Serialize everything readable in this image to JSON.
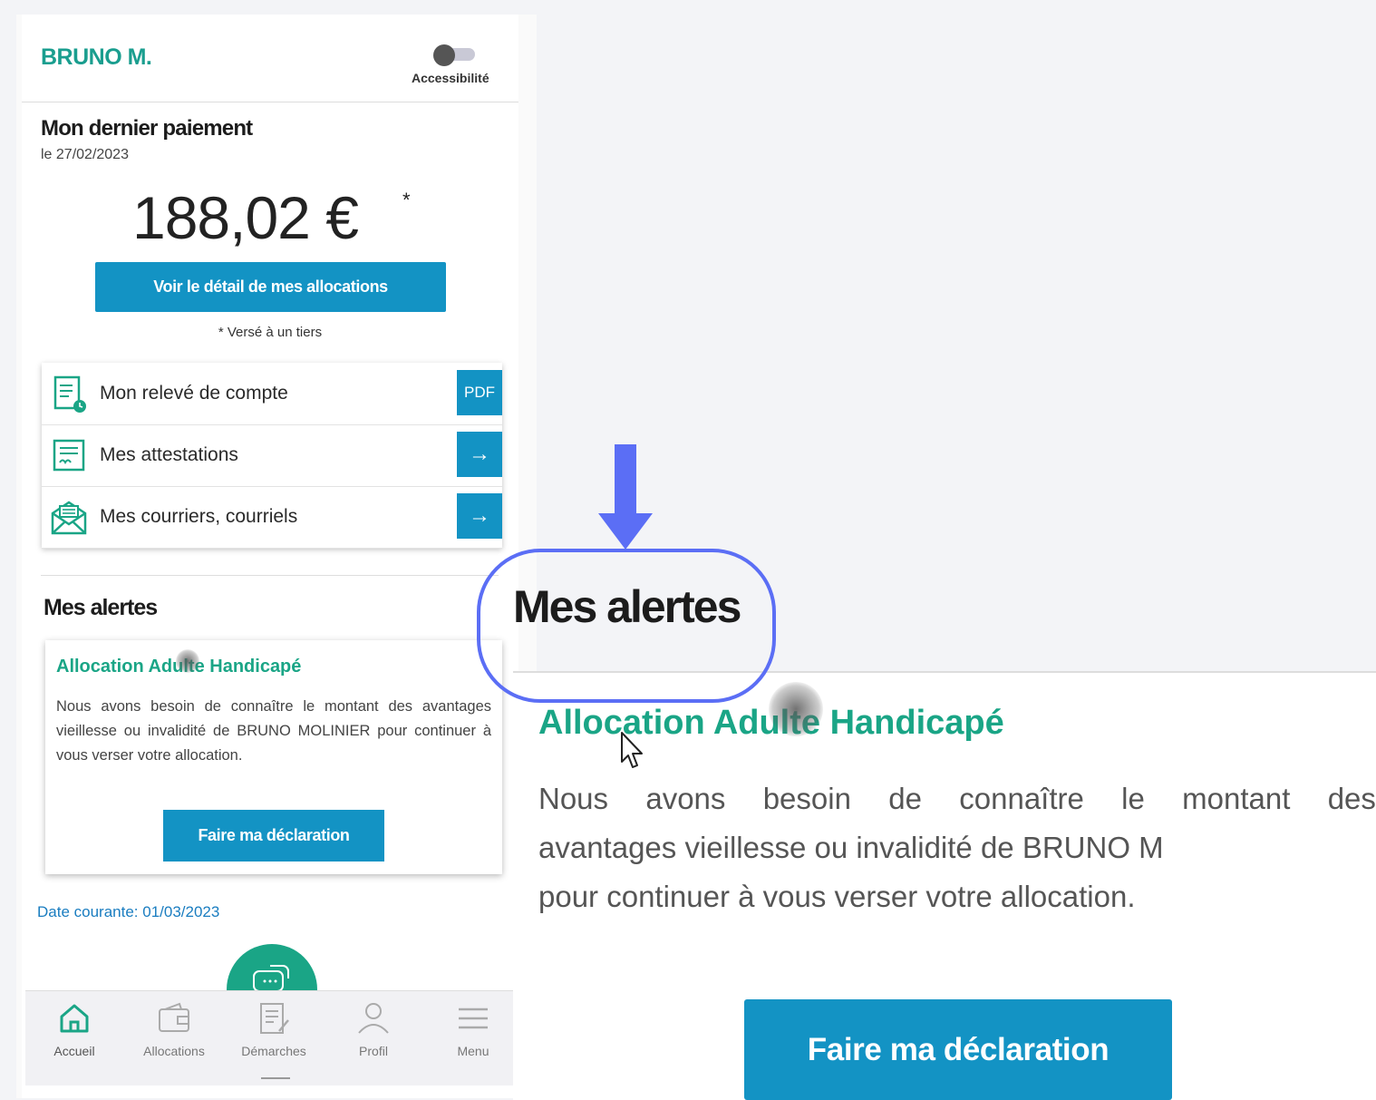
{
  "header": {
    "user_name": "BRUNO M.",
    "accessibility_label": "Accessibilité"
  },
  "payment": {
    "title": "Mon dernier paiement",
    "date": "le 27/02/2023",
    "amount": "188,02 €",
    "amount_marker": "*",
    "detail_button": "Voir le détail de mes allocations",
    "note": "* Versé à un tiers"
  },
  "links": [
    {
      "label": "Mon relevé de compte",
      "action": "PDF",
      "icon": "statement-icon"
    },
    {
      "label": "Mes attestations",
      "action": "→",
      "icon": "certificate-icon"
    },
    {
      "label": "Mes courriers, courriels",
      "action": "→",
      "icon": "mail-icon"
    }
  ],
  "alerts": {
    "title": "Mes alertes",
    "heading": "Allocation Adulte Handicapé",
    "text": "Nous avons besoin de connaître le montant des avantages vieillesse ou invalidité de BRUNO MOLINIER pour continuer à vous verser votre allocation.",
    "button": "Faire ma déclaration"
  },
  "date_current": "Date courante: 01/03/2023",
  "bottom_nav": [
    {
      "label": "Accueil",
      "icon": "home-icon",
      "active": true
    },
    {
      "label": "Allocations",
      "icon": "wallet-icon",
      "active": false
    },
    {
      "label": "Démarches",
      "icon": "document-edit-icon",
      "active": false
    },
    {
      "label": "Profil",
      "icon": "user-icon",
      "active": false
    },
    {
      "label": "Menu",
      "icon": "hamburger-icon",
      "active": false
    }
  ],
  "zoom": {
    "title": "Mes alertes",
    "heading": "Allocation Adulte Handicapé",
    "line1_words": [
      "Nous",
      "avons",
      "besoin",
      "de",
      "connaître",
      "le",
      "montant",
      "des"
    ],
    "line2": "avantages vieillesse ou invalidité de BRUNO M",
    "line3": "pour continuer à vous verser votre allocation.",
    "button": "Faire ma déclaration"
  },
  "colors": {
    "brand_green": "#1aa586",
    "primary_blue": "#1393c4",
    "highlight": "#5b6ef5"
  }
}
